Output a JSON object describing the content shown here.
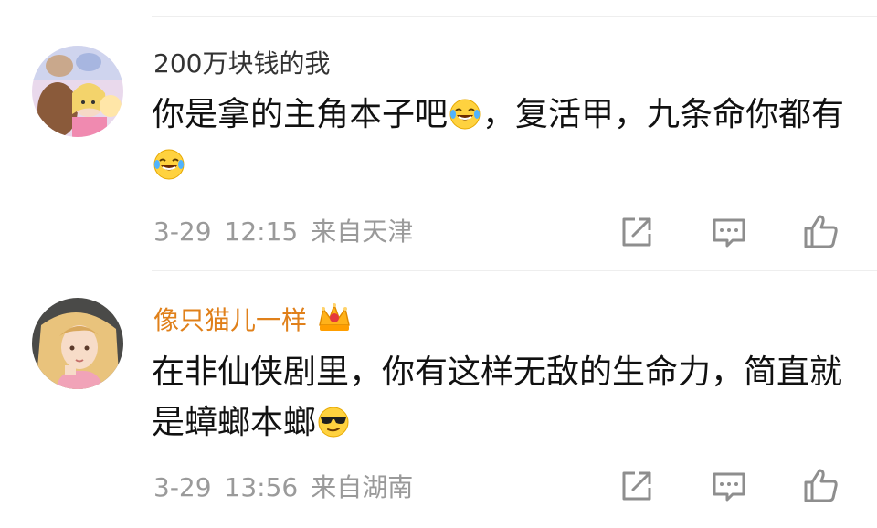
{
  "comments": [
    {
      "username": "200万块钱的我",
      "content_parts": [
        "你是拿的主角本子吧",
        "，复活甲，九条命你都有"
      ],
      "emojis": [
        "laughing-crying-emoji",
        "laughing-crying-emoji"
      ],
      "date": "3-29",
      "time": "12:15",
      "location": "来自天津",
      "username_color": "#333333",
      "vip": false
    },
    {
      "username": "像只猫儿一样",
      "content_parts": [
        "在非仙侠剧里，你有这样无敌的生命力，简直就是蟑螂本螂"
      ],
      "emojis": [
        "sunglasses-emoji"
      ],
      "date": "3-29",
      "time": "13:56",
      "location": "来自湖南",
      "username_color": "#e0801a",
      "vip": true,
      "vip_icon": "crown-icon"
    }
  ],
  "actions": [
    "share-icon",
    "reply-icon",
    "like-icon"
  ],
  "colors": {
    "meta_gray": "#9a9a9a",
    "divider": "#eeeeee",
    "vip_orange": "#e0801a"
  }
}
